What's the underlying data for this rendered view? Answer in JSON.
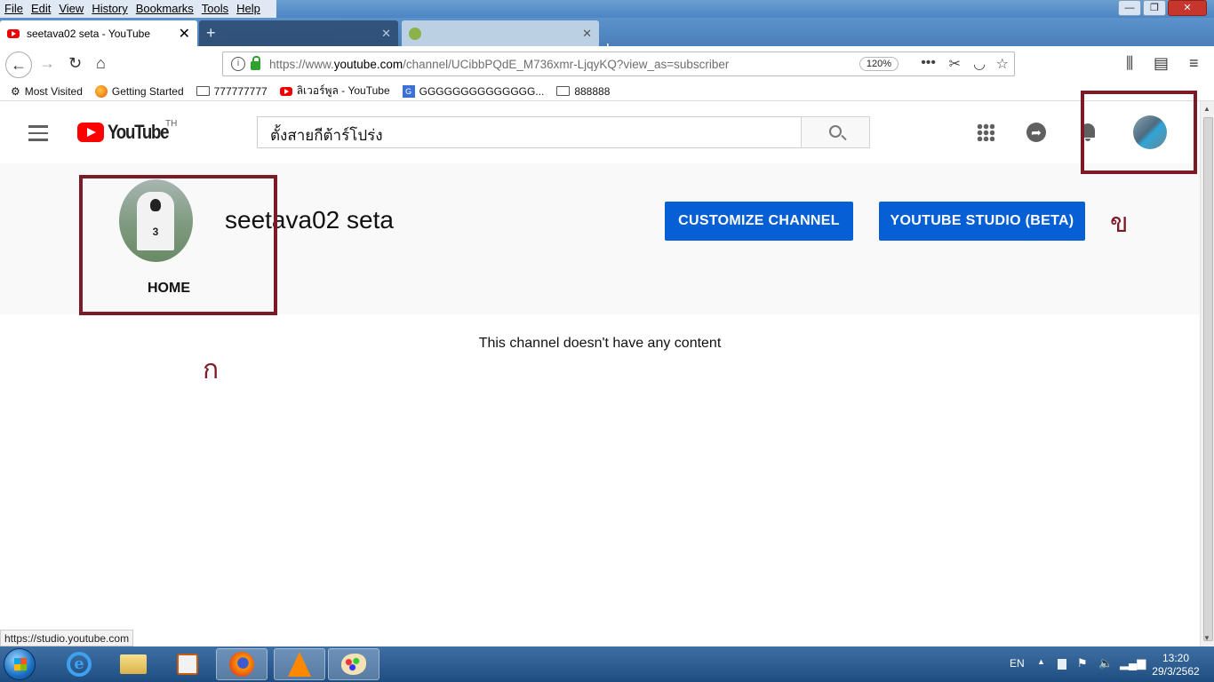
{
  "browser": {
    "menu": [
      "File",
      "Edit",
      "View",
      "History",
      "Bookmarks",
      "Tools",
      "Help"
    ],
    "tabs": [
      {
        "title": "seetava02 seta - YouTube",
        "active": true
      }
    ],
    "url": {
      "prefix": "https://www.",
      "domain": "youtube.com",
      "path": "/channel/UCibbPQdE_M736xmr-LjqyKQ?view_as=subscriber",
      "zoom": "120%"
    },
    "bookmarks": [
      {
        "label": "Most Visited",
        "icon": "gear-icon"
      },
      {
        "label": "Getting Started",
        "icon": "firefox-icon"
      },
      {
        "label": "777777777",
        "icon": "folder-icon"
      },
      {
        "label": "ลิเวอร์พูล - YouTube",
        "icon": "youtube-icon"
      },
      {
        "label": "GGGGGGGGGGGGGG...",
        "icon": "google-translate-icon"
      },
      {
        "label": "888888",
        "icon": "folder-icon"
      }
    ],
    "status_url": "https://studio.youtube.com"
  },
  "youtube": {
    "logo_text": "YouTube",
    "country_code": "TH",
    "search_value": "ตั้งสายกีต้าร์โปร่ง",
    "channel_name": "seetava02 seta",
    "customize_label": "CUSTOMIZE CHANNEL",
    "studio_label": "YOUTUBE STUDIO (BETA)",
    "home_tab": "HOME",
    "empty_message": "This channel doesn't have any content",
    "avatar_milestone_number": "3",
    "brand_color": "#ff0000",
    "button_color": "#065fd4"
  },
  "annotations": {
    "label_a": "ก",
    "label_b": "ข",
    "color": "#7b1b28"
  },
  "taskbar": {
    "apps": [
      "internet-explorer",
      "file-explorer",
      "media-player",
      "firefox",
      "vlc",
      "paint"
    ],
    "language": "EN",
    "time": "13:20",
    "date": "29/3/2562"
  }
}
